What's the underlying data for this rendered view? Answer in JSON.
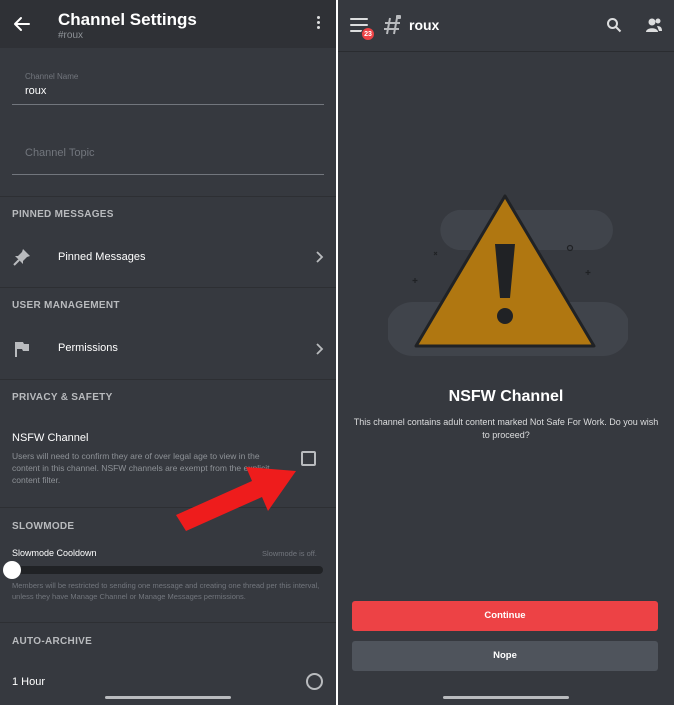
{
  "left": {
    "header": {
      "title": "Channel Settings",
      "subtitle": "#roux"
    },
    "channel_name": {
      "label": "Channel Name",
      "value": "roux"
    },
    "channel_topic": {
      "placeholder": "Channel Topic"
    },
    "sections": {
      "pinned": {
        "heading": "PINNED MESSAGES",
        "row": "Pinned Messages"
      },
      "user_mgmt": {
        "heading": "USER MANAGEMENT",
        "row": "Permissions"
      },
      "privacy": {
        "heading": "PRIVACY & SAFETY",
        "nsfw_title": "NSFW Channel",
        "nsfw_desc": "Users will need to confirm they are of over legal age to view in the content in this channel. NSFW channels are exempt from the explicit content filter.",
        "nsfw_checked": false
      },
      "slowmode": {
        "heading": "SLOWMODE",
        "label": "Slowmode Cooldown",
        "status": "Slowmode is off.",
        "level": 0,
        "desc": "Members will be restricted to sending one message and creating one thread per this interval, unless they have Manage Channel or Manage Messages permissions."
      },
      "auto_archive": {
        "heading": "AUTO-ARCHIVE",
        "option": "1 Hour",
        "selected": false
      }
    }
  },
  "right": {
    "header": {
      "channel": "roux",
      "badge": "23"
    },
    "prompt": {
      "title": "NSFW Channel",
      "body": "This channel contains adult content marked Not Safe For Work. Do you wish to proceed?"
    },
    "buttons": {
      "continue": "Continue",
      "nope": "Nope"
    }
  },
  "colors": {
    "background": "#36393f",
    "header_left": "#2f3136",
    "danger": "#ed4245",
    "secondary_button": "#4f545c",
    "warning_triangle": "#b07711",
    "annotation_arrow": "#ee1c1c"
  },
  "icons": [
    "back-arrow-icon",
    "more-vertical-icon",
    "pin-icon",
    "flag-icon",
    "chevron-right-icon",
    "menu-icon",
    "hashtag-icon",
    "search-icon",
    "members-icon"
  ]
}
